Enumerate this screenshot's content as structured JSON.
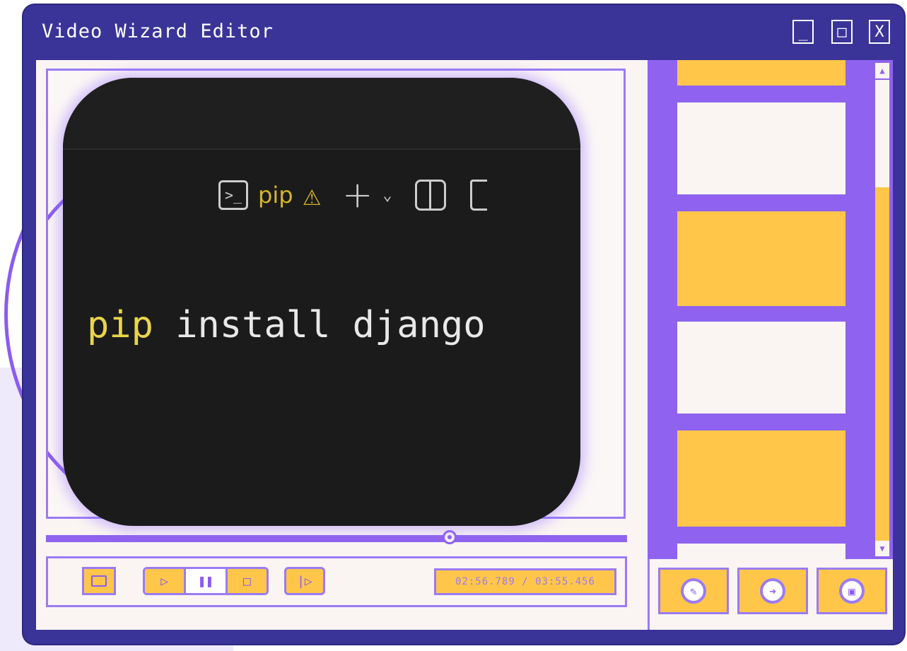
{
  "window": {
    "title": "Video Wizard Editor",
    "controls": {
      "minimize": "_",
      "maximize": "□",
      "close": "X"
    }
  },
  "terminal": {
    "tab_name": "pip",
    "shell_icon": "terminal-icon",
    "warning_icon": "warning-icon",
    "add_icon": "plus-icon",
    "dropdown_icon": "chevron-down-icon",
    "split_icon": "split-pane-icon",
    "trash_icon": "trash-icon",
    "command_keyword": "pip",
    "command_rest": " install django"
  },
  "playback": {
    "timecode": "02:56.789 / 03:55.456",
    "open_icon": "folder-icon",
    "play_icon": "play-icon",
    "pause_icon": "pause-icon",
    "stop_icon": "stop-icon",
    "next_icon": "skip-forward-icon"
  },
  "sidebar": {
    "thumbnails": [
      "yellow",
      "white",
      "yellow",
      "white",
      "yellow",
      "white"
    ],
    "scroll_up_icon": "arrow-up-icon",
    "scroll_down_icon": "arrow-down-icon"
  },
  "actions": {
    "edit_icon": "pencil-icon",
    "next_icon": "arrow-right-icon",
    "save_icon": "save-icon"
  },
  "colors": {
    "window": "#3a3498",
    "accent_purple": "#8f63ef",
    "accent_yellow": "#ffc64a",
    "panel_bg": "#faf5f3",
    "terminal_bg": "#1b1b1b",
    "terminal_keyword": "#e8d44d"
  }
}
